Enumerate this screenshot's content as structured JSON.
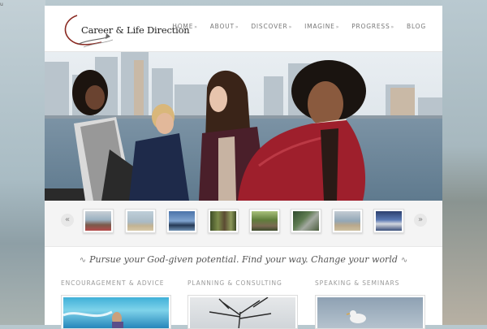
{
  "site": {
    "title": "Career & Life Direction"
  },
  "nav": [
    {
      "label": "HOME",
      "arrow": "»"
    },
    {
      "label": "ABOUT",
      "arrow": "»"
    },
    {
      "label": "DISCOVER",
      "arrow": "»"
    },
    {
      "label": "IMAGINE",
      "arrow": "»"
    },
    {
      "label": "PROGRESS",
      "arrow": "»"
    },
    {
      "label": "BLOG",
      "arrow": ""
    }
  ],
  "carousel": {
    "prev": "«",
    "next": "»",
    "thumbnail_count": 8
  },
  "tagline": {
    "text": "Pursue your God-given potential. Find your way. Change your world"
  },
  "columns": [
    {
      "title": "ENCOURAGEMENT & ADVICE"
    },
    {
      "title": "PLANNING & CONSULTING"
    },
    {
      "title": "SPEAKING & SEMINARS"
    }
  ],
  "corner_mark": "u",
  "colors": {
    "page_bg": "#ffffff",
    "nav_text": "#777777",
    "accent_swoosh": "#8a2a22"
  }
}
